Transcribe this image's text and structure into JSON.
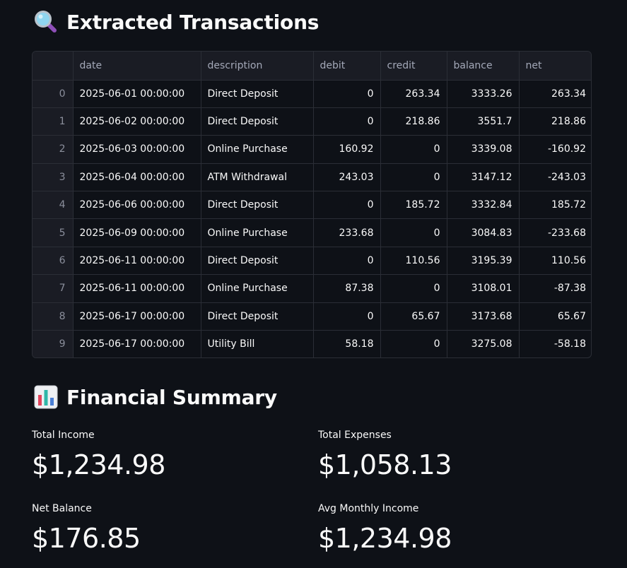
{
  "sections": {
    "transactions_title": "Extracted Transactions",
    "summary_title": "Financial Summary"
  },
  "icons": {
    "transactions": "magnifying-glass-icon",
    "summary": "bar-chart-icon"
  },
  "table": {
    "columns": [
      "",
      "date",
      "description",
      "debit",
      "credit",
      "balance",
      "net"
    ],
    "rows": [
      [
        "0",
        "2025-06-01 00:00:00",
        "Direct Deposit",
        "0",
        "263.34",
        "3333.26",
        "263.34"
      ],
      [
        "1",
        "2025-06-02 00:00:00",
        "Direct Deposit",
        "0",
        "218.86",
        "3551.7",
        "218.86"
      ],
      [
        "2",
        "2025-06-03 00:00:00",
        "Online Purchase",
        "160.92",
        "0",
        "3339.08",
        "-160.92"
      ],
      [
        "3",
        "2025-06-04 00:00:00",
        "ATM Withdrawal",
        "243.03",
        "0",
        "3147.12",
        "-243.03"
      ],
      [
        "4",
        "2025-06-06 00:00:00",
        "Direct Deposit",
        "0",
        "185.72",
        "3332.84",
        "185.72"
      ],
      [
        "5",
        "2025-06-09 00:00:00",
        "Online Purchase",
        "233.68",
        "0",
        "3084.83",
        "-233.68"
      ],
      [
        "6",
        "2025-06-11 00:00:00",
        "Direct Deposit",
        "0",
        "110.56",
        "3195.39",
        "110.56"
      ],
      [
        "7",
        "2025-06-11 00:00:00",
        "Online Purchase",
        "87.38",
        "0",
        "3108.01",
        "-87.38"
      ],
      [
        "8",
        "2025-06-17 00:00:00",
        "Direct Deposit",
        "0",
        "65.67",
        "3173.68",
        "65.67"
      ],
      [
        "9",
        "2025-06-17 00:00:00",
        "Utility Bill",
        "58.18",
        "0",
        "3275.08",
        "-58.18"
      ]
    ]
  },
  "metrics": {
    "total_income": {
      "label": "Total Income",
      "value": "$1,234.98"
    },
    "total_expenses": {
      "label": "Total Expenses",
      "value": "$1,058.13"
    },
    "net_balance": {
      "label": "Net Balance",
      "value": "$176.85"
    },
    "avg_monthly_income": {
      "label": "Avg Monthly Income",
      "value": "$1,234.98"
    }
  }
}
